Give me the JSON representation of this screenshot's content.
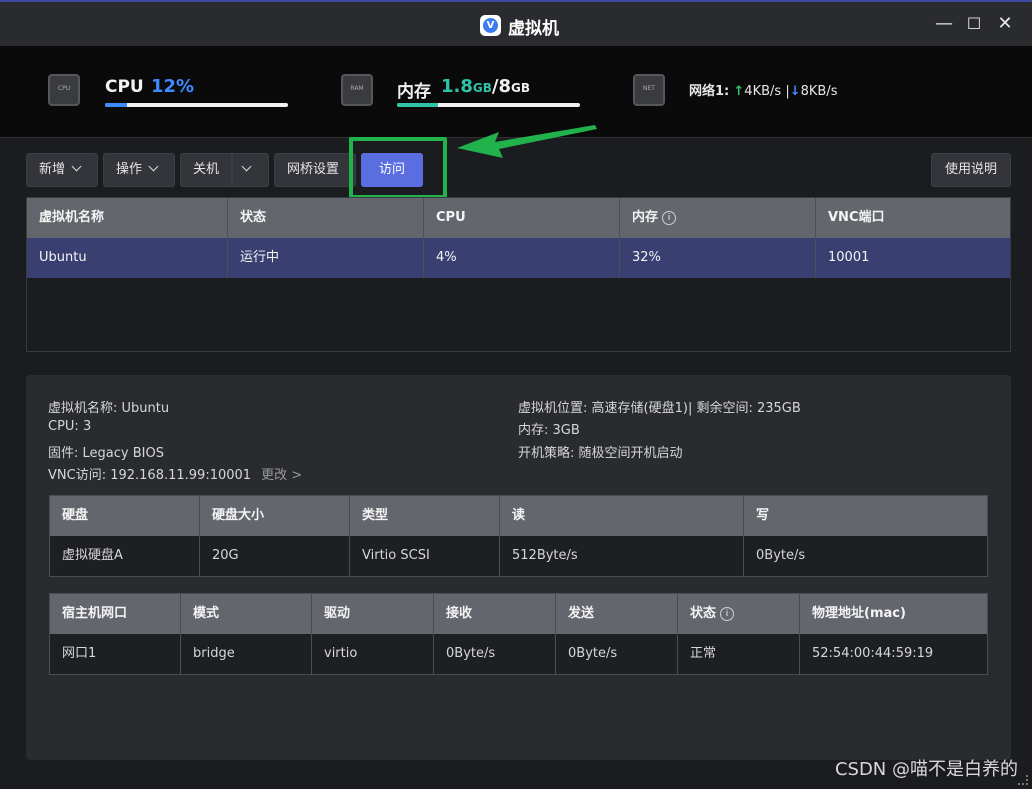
{
  "window": {
    "title": "虚拟机",
    "icon_letter": "V",
    "minimize": "—",
    "maximize": "☐",
    "close": "✕"
  },
  "stats": {
    "cpu": {
      "label": "CPU",
      "value": "12%",
      "percent": 12,
      "chip": "CPU",
      "color": "#3d8bff"
    },
    "mem": {
      "label": "内存",
      "used": "1.8",
      "used_unit": "GB",
      "sep": "/",
      "total": "8",
      "total_unit": "GB",
      "percent": 22.5,
      "chip": "RAM",
      "color": "#2fc3a8"
    },
    "net": {
      "label": "网络1:",
      "up_arrow": "↑",
      "up": "4KB/s",
      "sep": "|",
      "down_arrow": "↓",
      "down": "8KB/s",
      "chip": "NET"
    }
  },
  "toolbar": {
    "add": "新增",
    "operate": "操作",
    "shutdown": "关机",
    "bridge": "网桥设置",
    "visit": "访问",
    "help": "使用说明"
  },
  "vm_table": {
    "headers": [
      "虚拟机名称",
      "状态",
      "CPU",
      "内存",
      "VNC端口"
    ],
    "rows": [
      [
        "Ubuntu",
        "运行中",
        "4%",
        "32%",
        "10001"
      ]
    ]
  },
  "detail": {
    "name_label": "虚拟机名称:",
    "name": "Ubuntu",
    "cpu_label": "CPU:",
    "cpu": "3",
    "firmware_label": "固件:",
    "firmware": "Legacy BIOS",
    "vnc_label": "VNC访问:",
    "vnc": "192.168.11.99:10001",
    "change": "更改 >",
    "location_label": "虚拟机位置:",
    "location": "高速存储(硬盘1)| 剩余空间: 235GB",
    "mem_label": "内存:",
    "mem": "3GB",
    "boot_label": "开机策略:",
    "boot": "随极空间开机启动"
  },
  "disk_table": {
    "headers": [
      "硬盘",
      "硬盘大小",
      "类型",
      "读",
      "写"
    ],
    "rows": [
      [
        "虚拟硬盘A",
        "20G",
        "Virtio SCSI",
        "512Byte/s",
        "0Byte/s"
      ]
    ]
  },
  "nic_table": {
    "headers": [
      "宿主机网口",
      "模式",
      "驱动",
      "接收",
      "发送",
      "状态",
      "物理地址(mac)"
    ],
    "rows": [
      [
        "网口1",
        "bridge",
        "virtio",
        "0Byte/s",
        "0Byte/s",
        "正常",
        "52:54:00:44:59:19"
      ]
    ]
  },
  "watermark": "CSDN @喵不是白养的",
  "colors": {
    "accent": "#5b6ee0",
    "highlight": "#22b24c",
    "selected_row": "#3a3f72"
  }
}
